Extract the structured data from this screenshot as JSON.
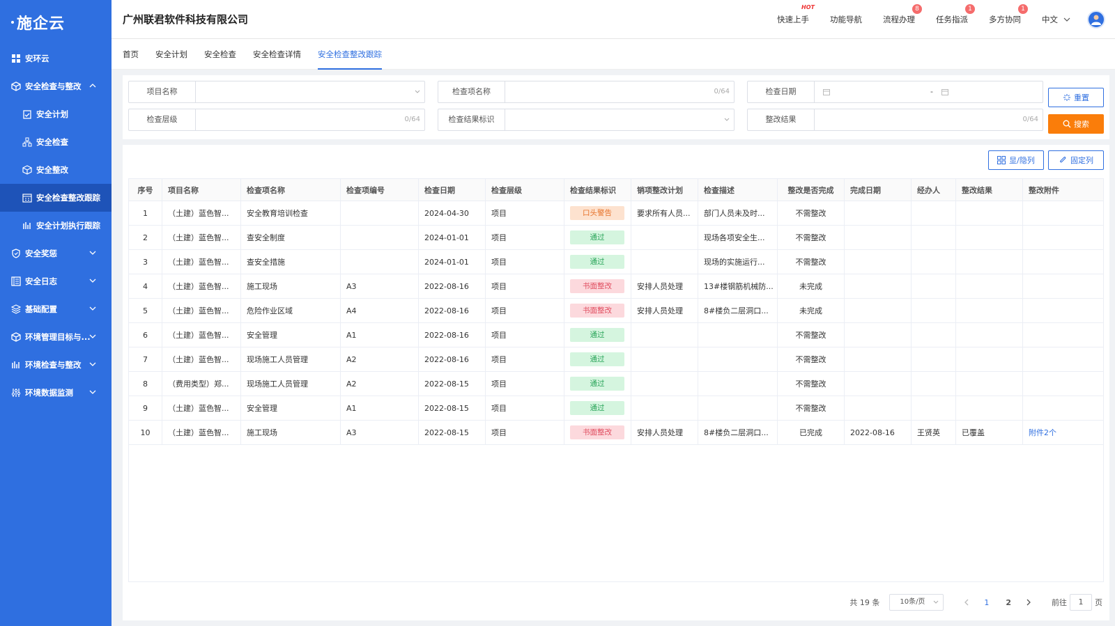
{
  "app": {
    "logo": "施企云"
  },
  "sidebar": {
    "items": [
      {
        "label": "安环云"
      },
      {
        "label": "安全检查与整改"
      },
      {
        "label": "安全计划"
      },
      {
        "label": "安全检查"
      },
      {
        "label": "安全整改"
      },
      {
        "label": "安全检查整改跟踪"
      },
      {
        "label": "安全计划执行跟踪"
      },
      {
        "label": "安全奖惩"
      },
      {
        "label": "安全日志"
      },
      {
        "label": "基础配置"
      },
      {
        "label": "环境管理目标与..."
      },
      {
        "label": "环境检查与整改"
      },
      {
        "label": "环境数据监测"
      }
    ]
  },
  "header": {
    "company": "广州联君软件科技有限公司",
    "quick_start": "快速上手",
    "hot": "HOT",
    "func_nav": "功能导航",
    "process": "流程办理",
    "process_badge": "8",
    "tasks": "任务指派",
    "tasks_badge": "1",
    "collab": "多方协同",
    "collab_badge": "1",
    "lang": "中文"
  },
  "tabs": [
    "首页",
    "安全计划",
    "安全检查",
    "安全检查详情",
    "安全检查整改跟踪"
  ],
  "filters": {
    "project_name": "项目名称",
    "check_item_name": "检查项名称",
    "check_date": "检查日期",
    "check_level": "检查层级",
    "result_flag": "检查结果标识",
    "rect_result": "整改结果",
    "counter": "0/64",
    "date_sep": "-",
    "reset": "重置",
    "search": "搜索"
  },
  "toolbar": {
    "toggle_cols": "显/隐列",
    "fix_cols": "固定列"
  },
  "table": {
    "headers": [
      "序号",
      "项目名称",
      "检查项名称",
      "检查项编号",
      "检查日期",
      "检查层级",
      "检查结果标识",
      "销项整改计划",
      "检查描述",
      "整改是否完成",
      "完成日期",
      "经办人",
      "整改结果",
      "整改附件"
    ],
    "rows": [
      {
        "no": "1",
        "project": "（土建）蓝色智...",
        "item": "安全教育培训检查",
        "code": "",
        "date": "2024-04-30",
        "level": "项目",
        "flag": "口头警告",
        "flag_type": "warn",
        "plan": "要求所有人员...",
        "desc": "部门人员未及时...",
        "done": "不需整改",
        "done_date": "",
        "handler": "",
        "result": "",
        "attach": ""
      },
      {
        "no": "2",
        "project": "（土建）蓝色智...",
        "item": "查安全制度",
        "code": "",
        "date": "2024-01-01",
        "level": "项目",
        "flag": "通过",
        "flag_type": "pass",
        "plan": "",
        "desc": "现场各项安全生...",
        "done": "不需整改",
        "done_date": "",
        "handler": "",
        "result": "",
        "attach": ""
      },
      {
        "no": "3",
        "project": "（土建）蓝色智...",
        "item": "查安全措施",
        "code": "",
        "date": "2024-01-01",
        "level": "项目",
        "flag": "通过",
        "flag_type": "pass",
        "plan": "",
        "desc": "现场的实施运行...",
        "done": "不需整改",
        "done_date": "",
        "handler": "",
        "result": "",
        "attach": ""
      },
      {
        "no": "4",
        "project": "（土建）蓝色智...",
        "item": "施工现场",
        "code": "A3",
        "date": "2022-08-16",
        "level": "项目",
        "flag": "书面整改",
        "flag_type": "fail",
        "plan": "安排人员处理",
        "desc": "13#楼钢筋机械防...",
        "done": "未完成",
        "done_date": "",
        "handler": "",
        "result": "",
        "attach": ""
      },
      {
        "no": "5",
        "project": "（土建）蓝色智...",
        "item": "危险作业区域",
        "code": "A4",
        "date": "2022-08-16",
        "level": "项目",
        "flag": "书面整改",
        "flag_type": "fail",
        "plan": "安排人员处理",
        "desc": "8#楼负二层洞口...",
        "done": "未完成",
        "done_date": "",
        "handler": "",
        "result": "",
        "attach": ""
      },
      {
        "no": "6",
        "project": "（土建）蓝色智...",
        "item": "安全管理",
        "code": "A1",
        "date": "2022-08-16",
        "level": "项目",
        "flag": "通过",
        "flag_type": "pass",
        "plan": "",
        "desc": "",
        "done": "不需整改",
        "done_date": "",
        "handler": "",
        "result": "",
        "attach": ""
      },
      {
        "no": "7",
        "project": "（土建）蓝色智...",
        "item": "现场施工人员管理",
        "code": "A2",
        "date": "2022-08-16",
        "level": "项目",
        "flag": "通过",
        "flag_type": "pass",
        "plan": "",
        "desc": "",
        "done": "不需整改",
        "done_date": "",
        "handler": "",
        "result": "",
        "attach": ""
      },
      {
        "no": "8",
        "project": "（费用类型）郑...",
        "item": "现场施工人员管理",
        "code": "A2",
        "date": "2022-08-15",
        "level": "项目",
        "flag": "通过",
        "flag_type": "pass",
        "plan": "",
        "desc": "",
        "done": "不需整改",
        "done_date": "",
        "handler": "",
        "result": "",
        "attach": ""
      },
      {
        "no": "9",
        "project": "（土建）蓝色智...",
        "item": "安全管理",
        "code": "A1",
        "date": "2022-08-15",
        "level": "项目",
        "flag": "通过",
        "flag_type": "pass",
        "plan": "",
        "desc": "",
        "done": "不需整改",
        "done_date": "",
        "handler": "",
        "result": "",
        "attach": ""
      },
      {
        "no": "10",
        "project": "（土建）蓝色智...",
        "item": "施工现场",
        "code": "A3",
        "date": "2022-08-15",
        "level": "项目",
        "flag": "书面整改",
        "flag_type": "fail",
        "plan": "安排人员处理",
        "desc": "8#楼负二层洞口...",
        "done": "已完成",
        "done_date": "2022-08-16",
        "handler": "王贤英",
        "result": "已覆盖",
        "attach": "附件2个"
      }
    ]
  },
  "pagination": {
    "total": "共 19 条",
    "page_size": "10条/页",
    "page1": "1",
    "page2": "2",
    "goto": "前往",
    "goto_value": "1",
    "page_unit": "页"
  },
  "colors": {
    "primary": "#2f6fe0",
    "search": "#fa7d0a",
    "sidebar": "#2f6fe0"
  }
}
